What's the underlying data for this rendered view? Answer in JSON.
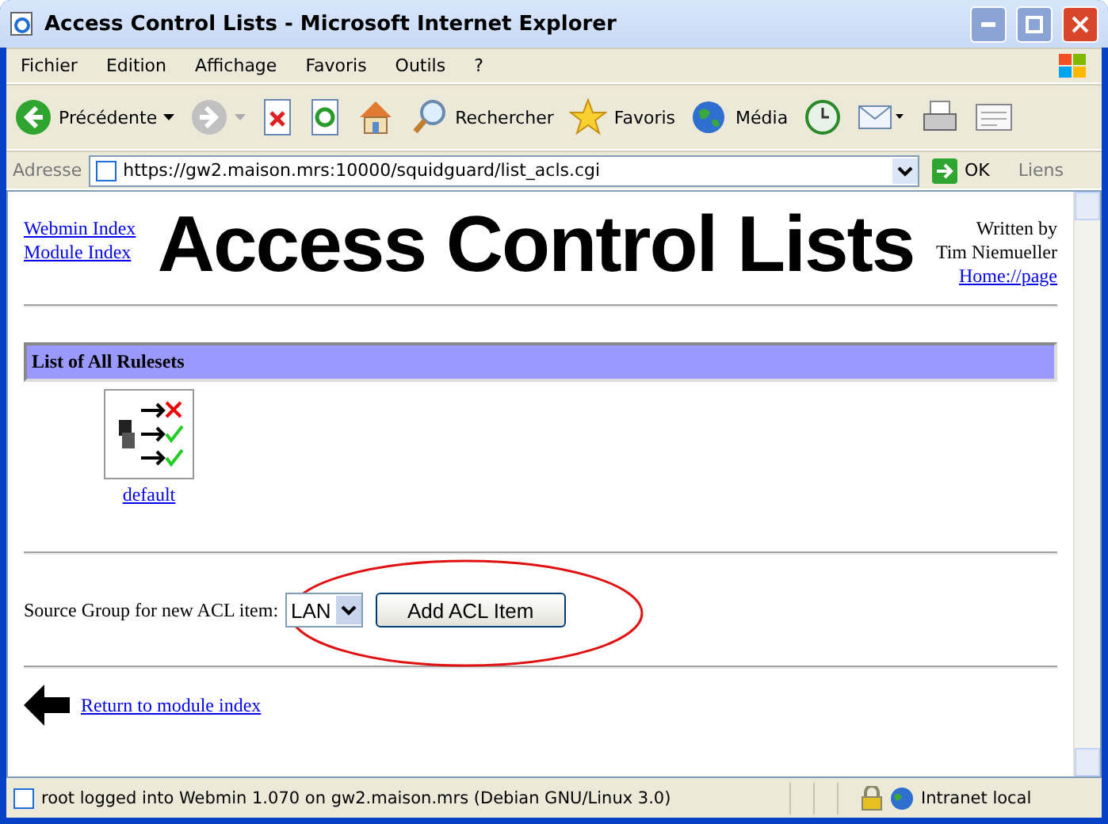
{
  "window": {
    "title": "Access Control Lists - Microsoft Internet Explorer"
  },
  "menu": [
    "Fichier",
    "Edition",
    "Affichage",
    "Favoris",
    "Outils",
    "?"
  ],
  "toolbar": [
    {
      "kind": "back",
      "label": "Précédente"
    },
    {
      "kind": "forward"
    },
    {
      "kind": "stop"
    },
    {
      "kind": "refresh"
    },
    {
      "kind": "home"
    },
    {
      "kind": "search",
      "label": "Rechercher"
    },
    {
      "kind": "favorites",
      "label": "Favoris"
    },
    {
      "kind": "media",
      "label": "Média"
    },
    {
      "kind": "history"
    },
    {
      "kind": "mail"
    },
    {
      "kind": "print"
    },
    {
      "kind": "edit"
    }
  ],
  "address": {
    "label": "Adresse",
    "value": "https://gw2.maison.mrs:10000/squidguard/list_acls.cgi",
    "go": "OK",
    "links": "Liens"
  },
  "page": {
    "nav_links": [
      "Webmin Index",
      "Module Index"
    ],
    "heading": "Access Control Lists",
    "author": [
      "Written by",
      "Tim Niemueller"
    ],
    "home_link": "Home://page",
    "section_title": "List of All Rulesets",
    "rulesets": [
      {
        "name": "default"
      }
    ],
    "form_label": "Source Group for new ACL item:",
    "select_value": "LAN",
    "add_button": "Add ACL Item",
    "return_link": "Return to module index"
  },
  "status_bar": {
    "text": "root logged into Webmin 1.070 on gw2.maison.mrs (Debian GNU/Linux 3.0)",
    "zone": "Intranet local"
  }
}
